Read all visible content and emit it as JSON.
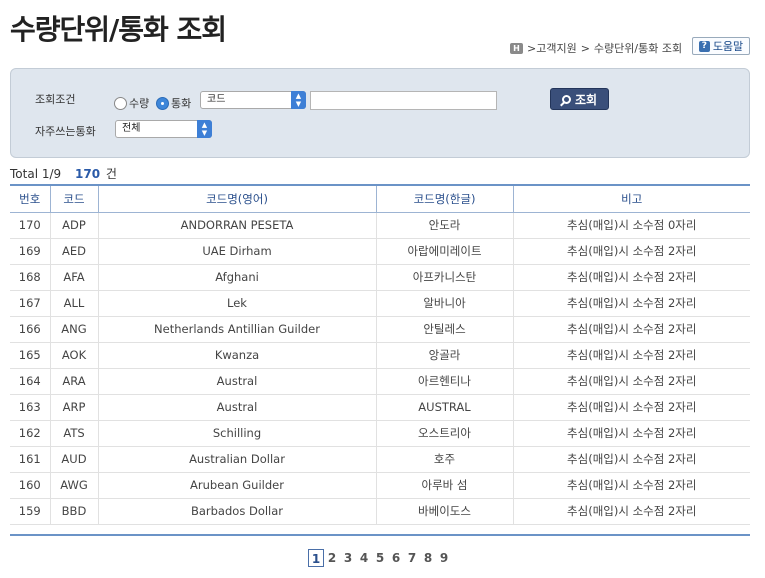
{
  "page_title": "수량단위/통화 조회",
  "breadcrumb": {
    "home_icon_label": "H",
    "items": [
      ">고객지원",
      ">",
      "수량단위/통화 조회"
    ]
  },
  "help_button": {
    "icon": "?",
    "label": "도움말"
  },
  "search": {
    "condition_label": "조회조건",
    "radio_quantity": "수량",
    "radio_currency": "통화",
    "selected_radio": "통화",
    "code_select_value": "코드",
    "text_value": "",
    "button_label": "조회",
    "frequent_label": "자주쓰는통화",
    "frequent_select_value": "전체"
  },
  "total": {
    "prefix": "Total",
    "page": "1/9",
    "count": "170",
    "unit": "건"
  },
  "table": {
    "headers": [
      "번호",
      "코드",
      "코드명(영어)",
      "코드명(한글)",
      "비고"
    ],
    "rows": [
      [
        "170",
        "ADP",
        "ANDORRAN PESETA",
        "안도라",
        "추심(매입)시 소수점 0자리"
      ],
      [
        "169",
        "AED",
        "UAE Dirham",
        "아랍에미레이트",
        "추심(매입)시 소수점 2자리"
      ],
      [
        "168",
        "AFA",
        "Afghani",
        "아프카니스탄",
        "추심(매입)시 소수점 2자리"
      ],
      [
        "167",
        "ALL",
        "Lek",
        "알바니아",
        "추심(매입)시 소수점 2자리"
      ],
      [
        "166",
        "ANG",
        "Netherlands Antillian Guilder",
        "안틸레스",
        "추심(매입)시 소수점 2자리"
      ],
      [
        "165",
        "AOK",
        "Kwanza",
        "앙골라",
        "추심(매입)시 소수점 2자리"
      ],
      [
        "164",
        "ARA",
        "Austral",
        "아르헨티나",
        "추심(매입)시 소수점 2자리"
      ],
      [
        "163",
        "ARP",
        "Austral",
        "AUSTRAL",
        "추심(매입)시 소수점 2자리"
      ],
      [
        "162",
        "ATS",
        "Schilling",
        "오스트리아",
        "추심(매입)시 소수점 2자리"
      ],
      [
        "161",
        "AUD",
        "Australian Dollar",
        "호주",
        "추심(매입)시 소수점 2자리"
      ],
      [
        "160",
        "AWG",
        "Arubean Guilder",
        "아루바 섬",
        "추심(매입)시 소수점 2자리"
      ],
      [
        "159",
        "BBD",
        "Barbados Dollar",
        "바베이도스",
        "추심(매입)시 소수점 2자리"
      ]
    ]
  },
  "pagination": {
    "pages": [
      "1",
      "2",
      "3",
      "4",
      "5",
      "6",
      "7",
      "8",
      "9"
    ],
    "current": "1"
  },
  "colors": {
    "accent": "#2a5aa8",
    "panel": "#dfe6ee",
    "button": "#3a4f7a"
  }
}
